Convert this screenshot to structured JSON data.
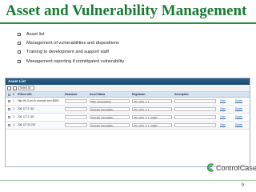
{
  "slide": {
    "title": "Asset and Vulnerability Management",
    "page_number": "9"
  },
  "bullets": [
    "Asset list",
    "Management of vulnerabilities and dispositions",
    "Training to development and support staff",
    "Management reporting if unmitigated vulnerability"
  ],
  "asset_list": {
    "panel_title": "Asset List",
    "toolbar": {
      "select_value": "Select All"
    },
    "columns": {
      "number": "#",
      "ip_url": "IP/Host URL",
      "hostname": "Hostname",
      "status": "Asset Status",
      "regulation": "Regulation",
      "description": "Description"
    },
    "rows": [
      {
        "num": "1",
        "ip": "http://fs-11xxx.lb.example.com:8080/",
        "hostname": "",
        "status": "Web vulnerabilities",
        "regulation": "PCI_DSS_1_1",
        "description": "",
        "view": "View",
        "delete": "Delete"
      },
      {
        "num": "2",
        "ip": "206.127.2.152",
        "hostname": "",
        "status": "Network vulnerability",
        "regulation": "PCI_DSS_1_1",
        "description": "",
        "view": "View",
        "delete": "Delete"
      },
      {
        "num": "3",
        "ip": "206.127.2.153",
        "hostname": "",
        "status": "Network vulnerability",
        "regulation": "PCI_DSS_1_1_CISET",
        "description": "",
        "view": "View",
        "delete": "Delete"
      },
      {
        "num": "4",
        "ip": "206.127.29.225",
        "hostname": "",
        "status": "Network vulnerability",
        "regulation": "PCI_DSS_1_1_CISET",
        "description": "",
        "view": "View",
        "delete": "Delete"
      }
    ]
  },
  "logo": {
    "text": "ControlCase",
    "icon": "controlcase-logo-icon"
  },
  "colors": {
    "title": "#1a7a35",
    "header": "#1c4a70",
    "link": "#1f5fa8",
    "accent": "#2e8b3e"
  }
}
